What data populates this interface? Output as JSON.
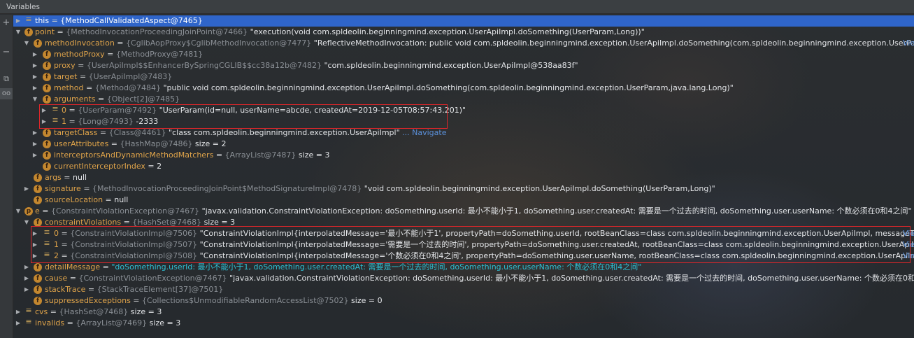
{
  "header": {
    "title": "Variables"
  },
  "gutter": {
    "add": "+",
    "minus": "−",
    "copy": "⧉",
    "watch": "oo"
  },
  "rows": [
    {
      "name": "this",
      "eq": " = ",
      "type": "{MethodCallValidatedAspect@7465}",
      "value": ""
    },
    {
      "name": "point",
      "eq": " = ",
      "type": "{MethodInvocationProceedingJoinPoint@7466}",
      "value": " \"execution(void com.spldeolin.beginningmind.exception.UserApiImpl.doSomething(UserParam,Long))\""
    },
    {
      "name": "methodInvocation",
      "eq": " = ",
      "type": "{CglibAopProxy$CglibMethodInvocation@7477}",
      "value": " \"ReflectiveMethodInvocation: public void com.spldeolin.beginningmind.exception.UserApiImpl.doSomething(com.spldeolin.beginningmind.exception.UserParam,java.lang.L...",
      "trail": "Vie"
    },
    {
      "name": "methodProxy",
      "eq": " = ",
      "type": "{MethodProxy@7481}",
      "value": ""
    },
    {
      "name": "proxy",
      "eq": " = ",
      "type": "{UserApiImpl$$EnhancerBySpringCGLIB$$cc38a12b@7482}",
      "value": " \"com.spldeolin.beginningmind.exception.UserApiImpl@538aa83f\""
    },
    {
      "name": "target",
      "eq": " = ",
      "type": "{UserApiImpl@7483}",
      "value": ""
    },
    {
      "name": "method",
      "eq": " = ",
      "type": "{Method@7484}",
      "value": " \"public void com.spldeolin.beginningmind.exception.UserApiImpl.doSomething(com.spldeolin.beginningmind.exception.UserParam,java.lang.Long)\""
    },
    {
      "name": "arguments",
      "eq": " = ",
      "type": "{Object[2]@7485}",
      "value": ""
    },
    {
      "name": "0",
      "eq": " = ",
      "type": "{UserParam@7492}",
      "value": " \"UserParam(id=null, userName=abcde, createdAt=2019-12-05T08:57:43.201)\""
    },
    {
      "name": "1",
      "eq": " = ",
      "type": "{Long@7493}",
      "value": " -2333"
    },
    {
      "name": "targetClass",
      "eq": " = ",
      "type": "{Class@4461}",
      "value": " \"class com.spldeolin.beginningmind.exception.UserApiImpl\"",
      "nav": " ... Navigate"
    },
    {
      "name": "userAttributes",
      "eq": " = ",
      "type": "{HashMap@7486}",
      "value": "  size = 2"
    },
    {
      "name": "interceptorsAndDynamicMethodMatchers",
      "eq": " = ",
      "type": "{ArrayList@7487}",
      "value": "  size = 3"
    },
    {
      "name": "currentInterceptorIndex",
      "eq": " = ",
      "type": "",
      "value": "2"
    },
    {
      "name": "args",
      "eq": " = ",
      "type": "",
      "value": "null"
    },
    {
      "name": "signature",
      "eq": " = ",
      "type": "{MethodInvocationProceedingJoinPoint$MethodSignatureImpl@7478}",
      "value": " \"void com.spldeolin.beginningmind.exception.UserApiImpl.doSomething(UserParam,Long)\""
    },
    {
      "name": "sourceLocation",
      "eq": " = ",
      "type": "",
      "value": "null"
    },
    {
      "name": "e",
      "eq": " = ",
      "type": "{ConstraintViolationException@7467}",
      "value": " \"javax.validation.ConstraintViolationException: doSomething.userId: 最小不能小于1, doSomething.user.createdAt: 需要是一个过去的时间, doSomething.user.userName: 个数必须在0和4之间\""
    },
    {
      "name": "constraintViolations",
      "eq": " = ",
      "type": "{HashSet@7468}",
      "value": "  size = 3"
    },
    {
      "name": "0",
      "eq": " = ",
      "type": "{ConstraintViolationImpl@7506}",
      "value": " \"ConstraintViolationImpl{interpolatedMessage='最小不能小于1', propertyPath=doSomething.userId, rootBeanClass=class com.spldeolin.beginningmind.exception.UserApiImpl, messageTemplate='{javax...",
      "trail": "Vie"
    },
    {
      "name": "1",
      "eq": " = ",
      "type": "{ConstraintViolationImpl@7507}",
      "value": " \"ConstraintViolationImpl{interpolatedMessage='需要是一个过去的时间', propertyPath=doSomething.user.createdAt, rootBeanClass=class com.spldeolin.beginningmind.exception.UserApiImpl, messageTe...",
      "trail": "Vie"
    },
    {
      "name": "2",
      "eq": " = ",
      "type": "{ConstraintViolationImpl@7508}",
      "value": " \"ConstraintViolationImpl{interpolatedMessage='个数必须在0和4之间', propertyPath=doSomething.user.userName, rootBeanClass=class com.spldeolin.beginningmind.exception.UserApiImpl, messageTen...",
      "trail": "Vie"
    },
    {
      "name": "detailMessage",
      "eq": " = ",
      "type": "",
      "value": "\"doSomething.userId: 最小不能小于1, doSomething.user.createdAt: 需要是一个过去的时间, doSomething.user.userName: 个数必须在0和4之间\""
    },
    {
      "name": "cause",
      "eq": " = ",
      "type": "{ConstraintViolationException@7467}",
      "value": " \"javax.validation.ConstraintViolationException: doSomething.userId: 最小不能小于1, doSomething.user.createdAt: 需要是一个过去的时间, doSomething.user.userName: 个数必须在0和4之间\""
    },
    {
      "name": "stackTrace",
      "eq": " = ",
      "type": "{StackTraceElement[37]@7501}",
      "value": ""
    },
    {
      "name": "suppressedExceptions",
      "eq": " = ",
      "type": "{Collections$UnmodifiableRandomAccessList@7502}",
      "value": "  size = 0"
    },
    {
      "name": "cvs",
      "eq": " = ",
      "type": "{HashSet@7468}",
      "value": "  size = 3"
    },
    {
      "name": "invalids",
      "eq": " = ",
      "type": "{ArrayList@7469}",
      "value": "  size = 3"
    }
  ]
}
